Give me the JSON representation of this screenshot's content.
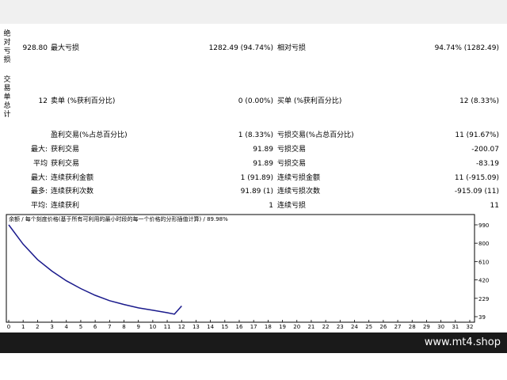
{
  "report": {
    "left_labels": {
      "abs_drawdown": "绝对亏损",
      "trades_total": "交易单总计"
    },
    "row1": {
      "left_value": "928.80",
      "max_dd_label": "最大亏损",
      "max_dd_value": "1282.49 (94.74%)",
      "rel_dd_label": "相对亏损",
      "rel_dd_value": "94.74% (1282.49)"
    },
    "row2": {
      "total": "12",
      "short_label": "卖单 (%获利百分比)",
      "short_value": "0 (0.00%)",
      "long_label": "买单 (%获利百分比)",
      "long_value": "12 (8.33%)"
    },
    "row3": {
      "profit_label": "盈利交易(%占总百分比)",
      "profit_value": "1 (8.33%)",
      "loss_label": "亏损交易(%占总百分比)",
      "loss_value": "11 (91.67%)"
    },
    "row4": {
      "prefix": "最大:",
      "profit_label": "获利交易",
      "profit_value": "91.89",
      "loss_label": "亏损交易",
      "loss_value": "-200.07"
    },
    "row5": {
      "prefix": "平均",
      "profit_label": "获利交易",
      "profit_value": "91.89",
      "loss_label": "亏损交易",
      "loss_value": "-83.19"
    },
    "row6": {
      "prefix": "最大:",
      "profit_label": "连续获利金额",
      "profit_value": "1 (91.89)",
      "loss_label": "连续亏损金额",
      "loss_value": "11 (-915.09)"
    },
    "row7": {
      "prefix": "最多:",
      "profit_label": "连续获利次数",
      "profit_value": "91.89 (1)",
      "loss_label": "连续亏损次数",
      "loss_value": "-915.09 (11)"
    },
    "row8": {
      "prefix": "平均:",
      "profit_label": "连续获利",
      "profit_value": "1",
      "loss_label": "连续亏损",
      "loss_value": "11"
    }
  },
  "chart_data": {
    "type": "line",
    "title": "余额 / 每个刻度价格(基于所有可利用的最小时段的每一个价格的分形插值计算) / 89.98%",
    "x_ticks": [
      "0",
      "1",
      "2",
      "3",
      "4",
      "5",
      "6",
      "7",
      "8",
      "9",
      "10",
      "11",
      "12",
      "13",
      "14",
      "15",
      "16",
      "17",
      "18",
      "19",
      "20",
      "21",
      "22",
      "23",
      "24",
      "25",
      "26",
      "27",
      "28",
      "29",
      "30",
      "31",
      "32"
    ],
    "y_ticks": [
      "990",
      "800",
      "610",
      "420",
      "229",
      "39"
    ],
    "xlim": [
      0,
      32
    ],
    "ylim": [
      39,
      990
    ],
    "grid": false,
    "line_color": "#1a1a8c",
    "series": [
      {
        "x": [
          0,
          1,
          2,
          3,
          4,
          5,
          6,
          7,
          8,
          9,
          10,
          11,
          11.5,
          12
        ],
        "y": [
          990,
          790,
          630,
          510,
          410,
          330,
          260,
          205,
          165,
          130,
          105,
          80,
          65,
          150
        ]
      }
    ]
  },
  "footer": {
    "brand": "www.mt4.shop"
  }
}
